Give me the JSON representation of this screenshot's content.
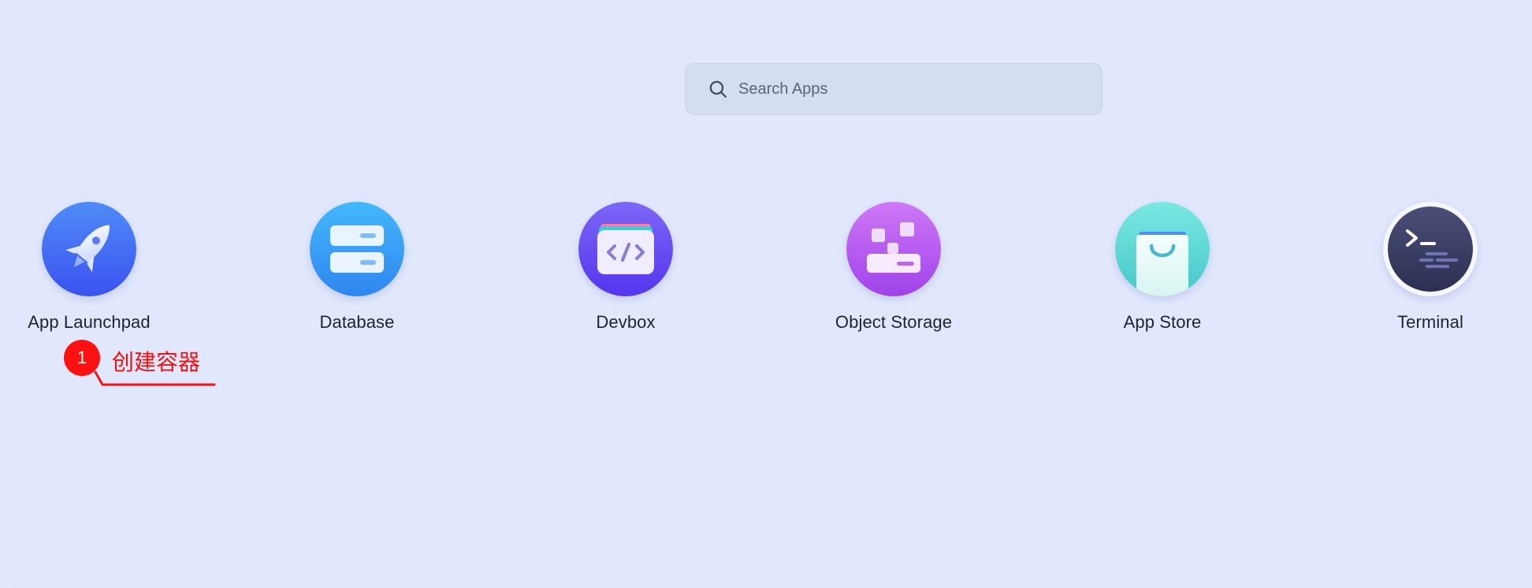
{
  "search": {
    "placeholder": "Search Apps",
    "value": ""
  },
  "apps": [
    {
      "label": "App Launchpad",
      "icon": "rocket-icon"
    },
    {
      "label": "Database",
      "icon": "database-icon"
    },
    {
      "label": "Devbox",
      "icon": "devbox-code-icon"
    },
    {
      "label": "Object Storage",
      "icon": "object-storage-icon"
    },
    {
      "label": "App Store",
      "icon": "shopping-bag-icon"
    },
    {
      "label": "Terminal",
      "icon": "terminal-icon"
    }
  ],
  "annotation": {
    "number": "1",
    "text": "创建容器",
    "color": "#ff1111"
  },
  "colors": {
    "background": "#e1e8fd",
    "search_background": "#d4def3",
    "launchpad": "#3c68f5",
    "database": "#38a4f6",
    "devbox": "#6a4cf2",
    "object_storage": "#b456ec",
    "app_store": "#5fd9d4",
    "terminal": "#3b3f68"
  }
}
